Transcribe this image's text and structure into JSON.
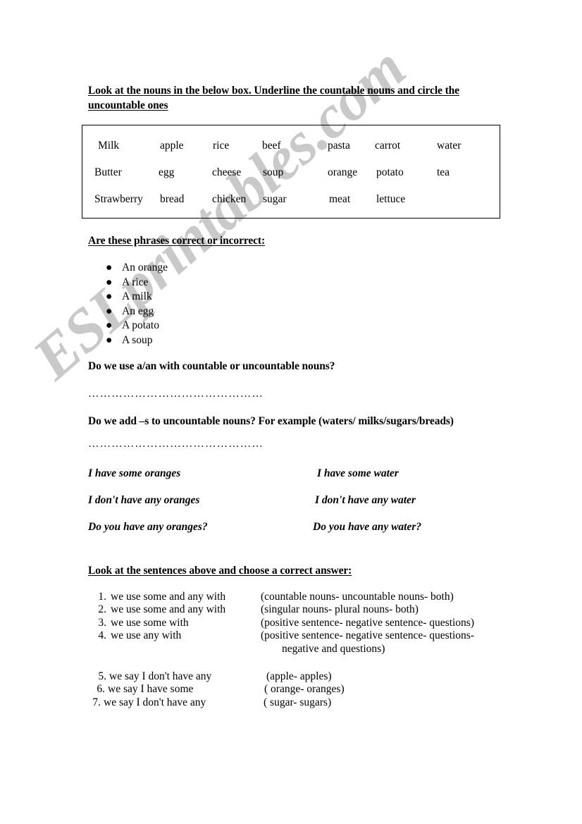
{
  "watermark": {
    "text": "ESLprintables.com",
    "color": "#c9c9c9"
  },
  "headings": {
    "task1_line1": "Look at the nouns in the below box. Underline the countable nouns and circle the",
    "task1_line2": "uncountable ones",
    "task2": "Are these phrases correct or incorrect:",
    "task3": "Look at the sentences above and choose a correct answer:"
  },
  "noun_box": {
    "rows": [
      [
        "Milk",
        "apple",
        "rice",
        "beef",
        "pasta",
        "carrot",
        "water"
      ],
      [
        "Butter",
        "egg",
        "cheese",
        "soup",
        "orange",
        "potato",
        "tea"
      ],
      [
        "Strawberry",
        "bread",
        "chicken",
        "sugar",
        "meat",
        "lettuce"
      ]
    ]
  },
  "phrases": [
    "An orange",
    "A rice",
    "A milk",
    "An egg",
    "A potato",
    "A soup"
  ],
  "bullet_glyph": "●",
  "questions": {
    "q1": "Do we use a/an with countable or uncountable nouns?",
    "q2": "Do we add –s to uncountable nouns? For example (waters/ milks/sugars/breads)",
    "answer_line": "………………………………………"
  },
  "examples": {
    "left": [
      "I have some oranges",
      "I don't have any oranges",
      "Do you have any oranges?"
    ],
    "right": [
      "I have some water",
      "I don't have any water",
      "Do you have any water?"
    ]
  },
  "choices": [
    {
      "num": "1.",
      "stem": "we use some and any with",
      "options": "(countable nouns- uncountable nouns- both)"
    },
    {
      "num": "2.",
      "stem": "we use some and any with",
      "options": "(singular nouns- plural nouns- both)"
    },
    {
      "num": "3.",
      "stem": "we use some with",
      "options": "(positive sentence- negative sentence- questions)"
    },
    {
      "num": "4.",
      "stem": "we use any with",
      "options": "(positive sentence- negative sentence- questions-",
      "options_cont": "negative and questions)"
    }
  ],
  "choices2": [
    {
      "num": "5.",
      "stem": "we say I don't have any",
      "options": "(apple- apples)"
    },
    {
      "num": "6.",
      "stem": "we say I have some",
      "options": "( orange- oranges)"
    },
    {
      "num": "7.",
      "stem": "we say I don't have any",
      "options": "( sugar- sugars)"
    }
  ]
}
